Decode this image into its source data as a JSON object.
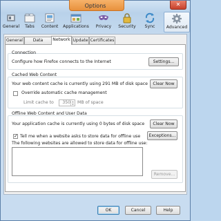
{
  "window": {
    "title": "Options",
    "close_glyph": "✕"
  },
  "toolbar": {
    "items": [
      {
        "label": "General",
        "icon": "switch-icon"
      },
      {
        "label": "Tabs",
        "icon": "tabs-icon"
      },
      {
        "label": "Content",
        "icon": "content-icon"
      },
      {
        "label": "Applications",
        "icon": "applications-icon"
      },
      {
        "label": "Privacy",
        "icon": "privacy-mask-icon"
      },
      {
        "label": "Security",
        "icon": "lock-icon"
      },
      {
        "label": "Sync",
        "icon": "sync-icon"
      },
      {
        "label": "Advanced",
        "icon": "gear-icon"
      }
    ],
    "active": "Advanced"
  },
  "subtabs": {
    "items": [
      "General",
      "Data Choices",
      "Network",
      "Update",
      "Certificates"
    ],
    "active": "Network"
  },
  "connection": {
    "heading": "Connection",
    "description": "Configure how Firefox connects to the Internet",
    "settings_button": "Settings..."
  },
  "cached": {
    "heading": "Cached Web Content",
    "status": "Your web content cache is currently using 291 MB of disk space",
    "clear_button": "Clear Now",
    "override_label": "Override automatic cache management",
    "override_checked": false,
    "limit_label": "Limit cache to",
    "limit_value": "350",
    "limit_unit": "MB of space"
  },
  "offline": {
    "heading": "Offline Web Content and User Data",
    "status": "Your application cache is currently using 0 bytes of disk space",
    "clear_button": "Clear Now",
    "tell_me_label": "Tell me when a website asks to store data for offline use",
    "tell_me_checked": true,
    "exceptions_button": "Exceptions...",
    "list_label": "The following websites are allowed to store data for offline use:",
    "remove_button": "Remove..."
  },
  "footer": {
    "ok": "OK",
    "cancel": "Cancel",
    "help": "Help"
  },
  "colors": {
    "accent": "#3c7fb1",
    "title_tab": "#e8913c",
    "close": "#c8412b"
  }
}
